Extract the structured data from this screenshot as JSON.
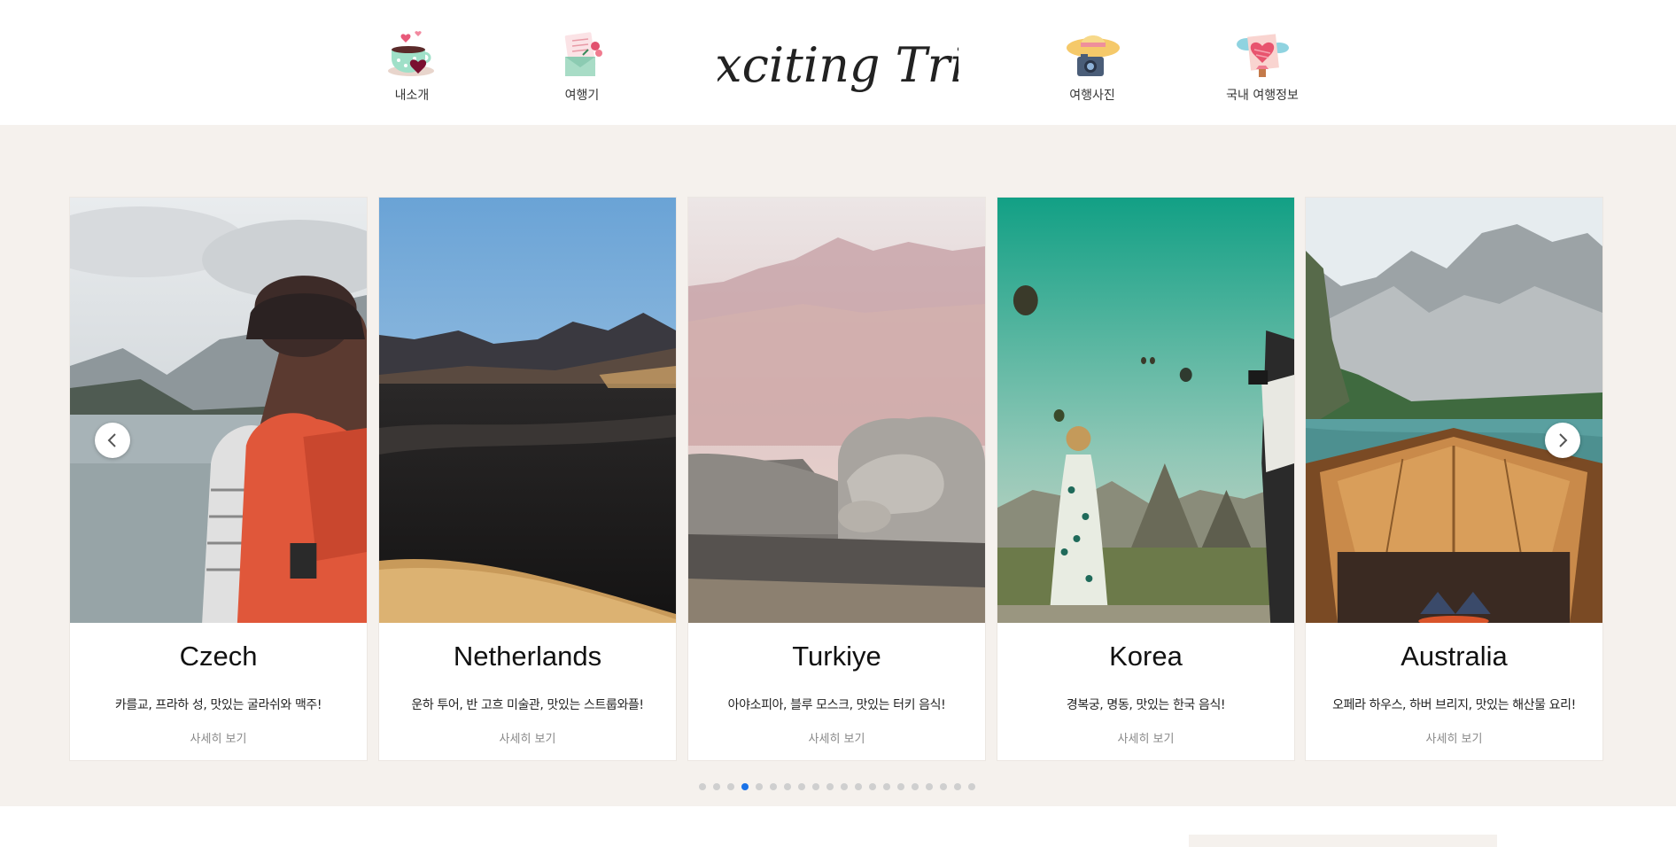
{
  "header": {
    "nav_left": [
      {
        "label": "내소개",
        "icon": "teacup-icon"
      },
      {
        "label": "여행기",
        "icon": "letter-icon"
      }
    ],
    "logo_text": "Exciting Trip",
    "nav_right": [
      {
        "label": "여행사진",
        "icon": "camera-hat-icon"
      },
      {
        "label": "국내 여행정보",
        "icon": "heart-map-icon"
      }
    ]
  },
  "slider": {
    "cards": [
      {
        "title": "Czech",
        "desc": "카를교, 프라하 성, 맛있는 굴라쉬와 맥주!",
        "more": "사세히 보기"
      },
      {
        "title": "Netherlands",
        "desc": "운하 투어, 반 고흐 미술관, 맛있는 스트룹와플!",
        "more": "사세히 보기"
      },
      {
        "title": "Turkiye",
        "desc": "아야소피아, 블루 모스크, 맛있는 터키 음식!",
        "more": "사세히 보기"
      },
      {
        "title": "Korea",
        "desc": "경복궁, 명동, 맛있는 한국 음식!",
        "more": "사세히 보기"
      },
      {
        "title": "Australia",
        "desc": "오페라 하우스, 하버 브리지, 맛있는 해산물 요리!",
        "more": "사세히 보기"
      }
    ],
    "dot_count": 20,
    "active_dot": 4
  },
  "colors": {
    "section_bg": "#f5f1ed",
    "active_dot": "#1a73e8"
  }
}
